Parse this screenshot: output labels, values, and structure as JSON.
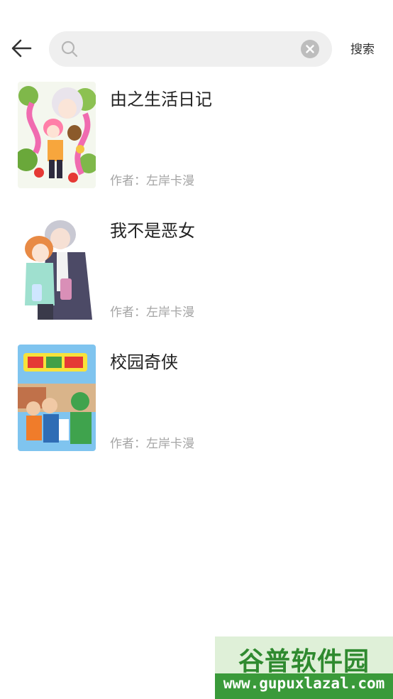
{
  "header": {
    "back_icon": "arrow-left-icon",
    "search": {
      "placeholder": "",
      "value": "",
      "icon": "search-icon",
      "clear_icon": "clear-icon"
    },
    "search_button_label": "搜索"
  },
  "results": [
    {
      "title": "由之生活日记",
      "author": "作者：左岸卡漫"
    },
    {
      "title": "我不是恶女",
      "author": "作者：左岸卡漫"
    },
    {
      "title": "校园奇侠",
      "author": "作者：左岸卡漫"
    }
  ],
  "watermark": {
    "title": "谷普软件园",
    "url": "www.gupuxlazal.com"
  },
  "colors": {
    "search_bg": "#efefef",
    "author_text": "#a5a5a5",
    "watermark_green": "#2f8a2f"
  }
}
